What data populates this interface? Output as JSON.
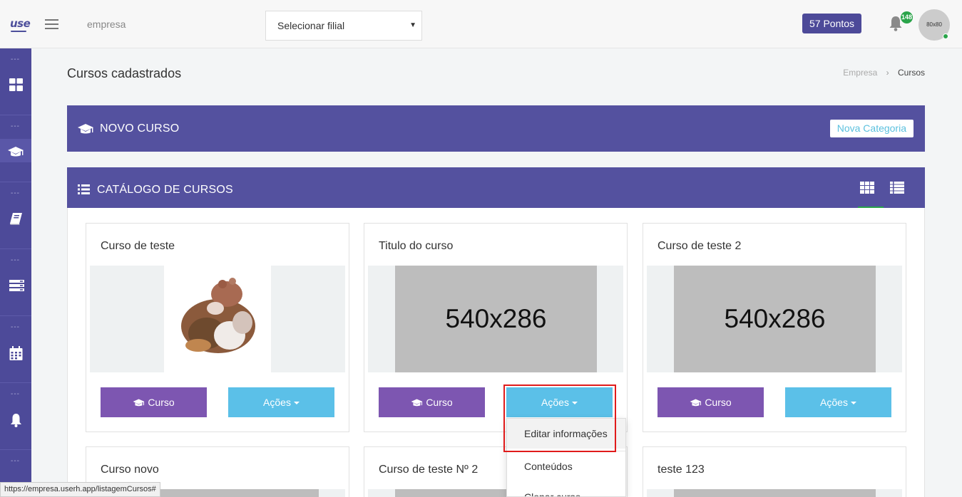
{
  "header": {
    "logo": "use",
    "company": "empresa",
    "branch_select": "Selecionar filial",
    "points": "57 Pontos",
    "notifications": "148",
    "avatar": "80x80"
  },
  "sidebar": {
    "dots": "---",
    "items": [
      {
        "icon": "dashboard-icon"
      },
      {
        "icon": "graduation-cap-icon",
        "active": true
      },
      {
        "icon": "book-icon"
      },
      {
        "icon": "list-icon"
      },
      {
        "icon": "calendar-icon"
      },
      {
        "icon": "bell-icon"
      }
    ]
  },
  "page": {
    "title": "Cursos cadastrados",
    "breadcrumb": [
      "Empresa",
      "Cursos"
    ]
  },
  "novo_curso": {
    "title": "NOVO CURSO",
    "button": "Nova Categoria"
  },
  "catalogo": {
    "title": "CATÁLOGO DE CURSOS",
    "view_modes": [
      "grid-view-icon",
      "list-view-icon"
    ]
  },
  "cards": [
    {
      "title": "Curso de teste",
      "image": "photo",
      "btn_curso": "Curso",
      "btn_acoes": "Ações"
    },
    {
      "title": "Titulo do curso",
      "image": "540x286",
      "btn_curso": "Curso",
      "btn_acoes": "Ações"
    },
    {
      "title": "Curso de teste 2",
      "image": "540x286",
      "btn_curso": "Curso",
      "btn_acoes": "Ações"
    },
    {
      "title": "Curso novo"
    },
    {
      "title": "Curso de teste Nº 2"
    },
    {
      "title": "teste 123"
    }
  ],
  "dropdown": {
    "items": [
      "Editar informações",
      "Conteúdos",
      "Clonar curso"
    ]
  },
  "status_bar": "https://empresa.userh.app/listagemCursos#",
  "colors": {
    "primary": "#54519f",
    "sidebar": "#4d4a99",
    "curso_button": "#7d56b1",
    "acoes_button": "#5bc0e8",
    "success": "#2aa44a",
    "highlight": "#e01b1b"
  }
}
